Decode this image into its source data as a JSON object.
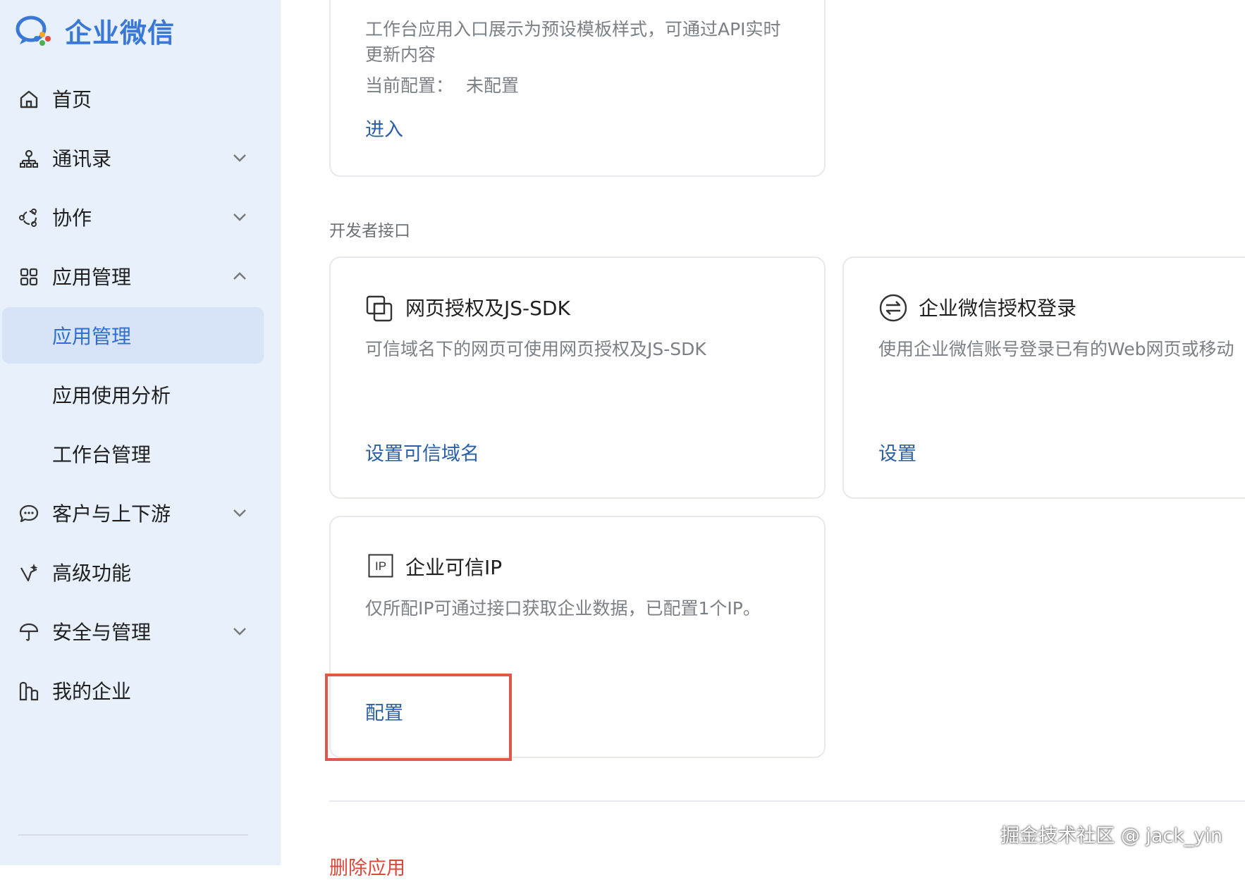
{
  "brand": {
    "name": "企业微信",
    "color": "#3a78d8"
  },
  "sidebar": {
    "items": [
      {
        "label": "首页",
        "icon": "home-icon"
      },
      {
        "label": "通讯录",
        "icon": "org-chart-icon",
        "chevron": "chevron-down-icon"
      },
      {
        "label": "协作",
        "icon": "collaboration-icon",
        "chevron": "chevron-down-icon"
      },
      {
        "label": "应用管理",
        "icon": "apps-grid-icon",
        "chevron": "chevron-up-icon",
        "expanded": true
      },
      {
        "label": "客户与上下游",
        "icon": "chat-bubble-icon",
        "chevron": "chevron-down-icon"
      },
      {
        "label": "高级功能",
        "icon": "sparkle-pen-icon"
      },
      {
        "label": "安全与管理",
        "icon": "umbrella-icon",
        "chevron": "chevron-down-icon"
      },
      {
        "label": "我的企业",
        "icon": "building-icon"
      }
    ],
    "subitems": [
      {
        "label": "应用管理",
        "active": true
      },
      {
        "label": "应用使用分析",
        "active": false
      },
      {
        "label": "工作台管理",
        "active": false
      }
    ]
  },
  "top_card": {
    "desc": "工作台应用入口展示为预设模板样式，可通过API实时更新内容",
    "config_label": "当前配置：",
    "config_value": "未配置",
    "link": "进入"
  },
  "section": {
    "label": "开发者接口"
  },
  "cards": [
    {
      "title": "网页授权及JS-SDK",
      "icon": "web-auth-icon",
      "desc": "可信域名下的网页可使用网页授权及JS-SDK",
      "link": "设置可信域名"
    },
    {
      "title": "企业微信授权登录",
      "icon": "switch-arrows-icon",
      "desc": "使用企业微信账号登录已有的Web网页或移动",
      "link": "设置"
    },
    {
      "title": "企业可信IP",
      "icon": "ip-icon",
      "desc": "仅所配IP可通过接口获取企业数据，已配置1个IP。",
      "link": "配置"
    }
  ],
  "delete_link": "删除应用",
  "watermark": "掘金技术社区 @ jack_yin",
  "colors": {
    "sidebar_bg": "#e8f0fb",
    "active_bg": "#d7e3f6",
    "link": "#2b5fa8",
    "highlight": "#e0574b",
    "danger": "#d9483b"
  }
}
